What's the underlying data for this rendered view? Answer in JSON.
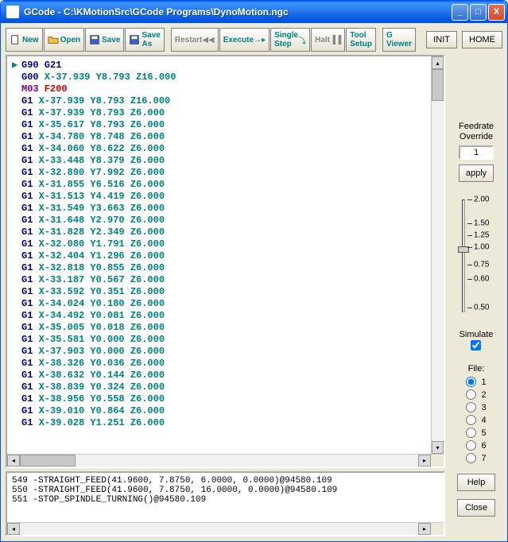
{
  "title": "GCode - C:\\KMotionSrc\\GCode Programs\\DynoMotion.ngc",
  "winbtn": {
    "min": "_",
    "max": "□",
    "close": "X"
  },
  "toolbar": {
    "new": "New",
    "open": "Open",
    "save": "Save",
    "saveas": "Save\nAs",
    "restart": "Restart",
    "execute": "Execute",
    "singlestep": "Single\nStep",
    "halt": "Halt",
    "toolsetup": "Tool\nSetup",
    "gviewer": "G\nViewer",
    "init": "INIT",
    "home": "HOME"
  },
  "code": [
    {
      "ptr": "▶",
      "cmd": "G90 G21",
      "rest": ""
    },
    {
      "ptr": "",
      "cmd": "G00",
      "rest": " X-37.939 Y8.793 Z16.000"
    },
    {
      "ptr": "",
      "m": "M03",
      "feed": " F200"
    },
    {
      "ptr": "",
      "cmd": "G1",
      "rest": " X-37.939 Y8.793 Z16.000"
    },
    {
      "ptr": "",
      "cmd": "G1",
      "rest": " X-37.939 Y8.793 Z6.000"
    },
    {
      "ptr": "",
      "cmd": "G1",
      "rest": " X-35.617 Y8.793 Z6.000"
    },
    {
      "ptr": "",
      "cmd": "G1",
      "rest": " X-34.780 Y8.748 Z6.000"
    },
    {
      "ptr": "",
      "cmd": "G1",
      "rest": " X-34.060 Y8.622 Z6.000"
    },
    {
      "ptr": "",
      "cmd": "G1",
      "rest": " X-33.448 Y8.379 Z6.000"
    },
    {
      "ptr": "",
      "cmd": "G1",
      "rest": " X-32.890 Y7.992 Z6.000"
    },
    {
      "ptr": "",
      "cmd": "G1",
      "rest": " X-31.855 Y6.516 Z6.000"
    },
    {
      "ptr": "",
      "cmd": "G1",
      "rest": " X-31.513 Y4.419 Z6.000"
    },
    {
      "ptr": "",
      "cmd": "G1",
      "rest": " X-31.549 Y3.663 Z6.000"
    },
    {
      "ptr": "",
      "cmd": "G1",
      "rest": " X-31.648 Y2.970 Z6.000"
    },
    {
      "ptr": "",
      "cmd": "G1",
      "rest": " X-31.828 Y2.349 Z6.000"
    },
    {
      "ptr": "",
      "cmd": "G1",
      "rest": " X-32.080 Y1.791 Z6.000"
    },
    {
      "ptr": "",
      "cmd": "G1",
      "rest": " X-32.404 Y1.296 Z6.000"
    },
    {
      "ptr": "",
      "cmd": "G1",
      "rest": " X-32.818 Y0.855 Z6.000"
    },
    {
      "ptr": "",
      "cmd": "G1",
      "rest": " X-33.187 Y0.567 Z6.000"
    },
    {
      "ptr": "",
      "cmd": "G1",
      "rest": " X-33.592 Y0.351 Z6.000"
    },
    {
      "ptr": "",
      "cmd": "G1",
      "rest": " X-34.024 Y0.180 Z6.000"
    },
    {
      "ptr": "",
      "cmd": "G1",
      "rest": " X-34.492 Y0.081 Z6.000"
    },
    {
      "ptr": "",
      "cmd": "G1",
      "rest": " X-35.005 Y0.018 Z6.000"
    },
    {
      "ptr": "",
      "cmd": "G1",
      "rest": " X-35.581 Y0.000 Z6.000"
    },
    {
      "ptr": "",
      "cmd": "G1",
      "rest": " X-37.903 Y0.000 Z6.000"
    },
    {
      "ptr": "",
      "cmd": "G1",
      "rest": " X-38.326 Y0.036 Z6.000"
    },
    {
      "ptr": "",
      "cmd": "G1",
      "rest": " X-38.632 Y0.144 Z6.000"
    },
    {
      "ptr": "",
      "cmd": "G1",
      "rest": " X-38.839 Y0.324 Z6.000"
    },
    {
      "ptr": "",
      "cmd": "G1",
      "rest": " X-38.956 Y0.558 Z6.000"
    },
    {
      "ptr": "",
      "cmd": "G1",
      "rest": " X-39.010 Y0.864 Z6.000"
    },
    {
      "ptr": "",
      "cmd": "G1",
      "rest": " X-39.028 Y1.251 Z6.000"
    }
  ],
  "log": [
    "549 -STRAIGHT_FEED(41.9600, 7.8750, 6.0000, 0.0000)@94580.109",
    "550 -STRAIGHT_FEED(41.9600, 7.8750, 16.0000, 0.0000)@94580.109",
    "551 -STOP_SPINDLE_TURNING()@94580.109"
  ],
  "right": {
    "feedrate": "Feedrate",
    "override": "Override",
    "value": "1",
    "apply": "apply",
    "ticks": [
      "2.00",
      "1.50",
      "1.25",
      "1.00",
      "0.75",
      "0.60",
      "0.50"
    ],
    "simulate": "Simulate",
    "simchecked": true,
    "file": "File:",
    "files": [
      "1",
      "2",
      "3",
      "4",
      "5",
      "6",
      "7"
    ],
    "selected": 0,
    "help": "Help",
    "close": "Close"
  }
}
